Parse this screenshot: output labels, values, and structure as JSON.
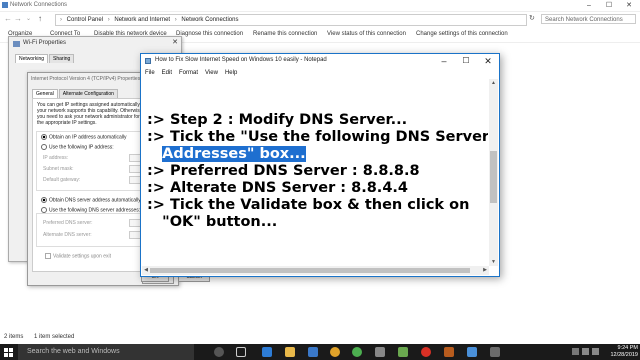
{
  "explorer": {
    "title": "Network Connections",
    "breadcrumb": [
      "Control Panel",
      "Network and Internet",
      "Network Connections"
    ],
    "search_placeholder": "Search Network Connections",
    "commands": [
      "Organize",
      "Connect To",
      "Disable this network device",
      "Diagnose this connection",
      "Rename this connection",
      "View status of this connection",
      "Change settings of this connection"
    ],
    "status_items": "2 items",
    "status_selected": "1 item selected"
  },
  "wifi_dialog": {
    "title": "Wi-Fi Properties",
    "tabs": [
      "Networking",
      "Sharing"
    ]
  },
  "ipv4_dialog": {
    "title": "Internet Protocol Version 4 (TCP/IPv4) Properties",
    "tabs": [
      "General",
      "Alternate Configuration"
    ],
    "description": "You can get IP settings assigned automatically if your network supports this capability. Otherwise, you need to ask your network administrator for the appropriate IP settings.",
    "radio_auto_ip": "Obtain an IP address automatically",
    "radio_static_ip": "Use the following IP address:",
    "ip_label": "IP address:",
    "subnet_label": "Subnet mask:",
    "gateway_label": "Default gateway:",
    "radio_auto_dns": "Obtain DNS server address automatically",
    "radio_static_dns": "Use the following DNS server addresses:",
    "preferred_dns_label": "Preferred DNS server:",
    "alternate_dns_label": "Alternate DNS server:",
    "validate_label": "Validate settings upon exit",
    "ok": "OK",
    "cancel": "Cancel"
  },
  "notepad": {
    "title": "How to Fix Slow Internet Speed on Windows 10 easily - Notepad",
    "menu": [
      "File",
      "Edit",
      "Format",
      "View",
      "Help"
    ],
    "lines": [
      ":> Step 2 : Modify DNS Server...",
      ":> Tick the \"Use the following DNS Server",
      "Addresses\" box...",
      ":> Preferred DNS Server : 8.8.8.8",
      ":> Alterate DNS Server : 8.8.4.4",
      ":> Tick the Validate box & then click on",
      "\"OK\" button..."
    ],
    "line3_indent": "   ",
    "line7_indent": "   "
  },
  "taskbar": {
    "search_text": "Search the web and Windows",
    "time": "9:24 PM",
    "date": "12/28/2019"
  },
  "colors": {
    "selection": "#1e6fd0",
    "notepad_border": "#1a73c8",
    "taskbar": "#1a1a1a"
  }
}
